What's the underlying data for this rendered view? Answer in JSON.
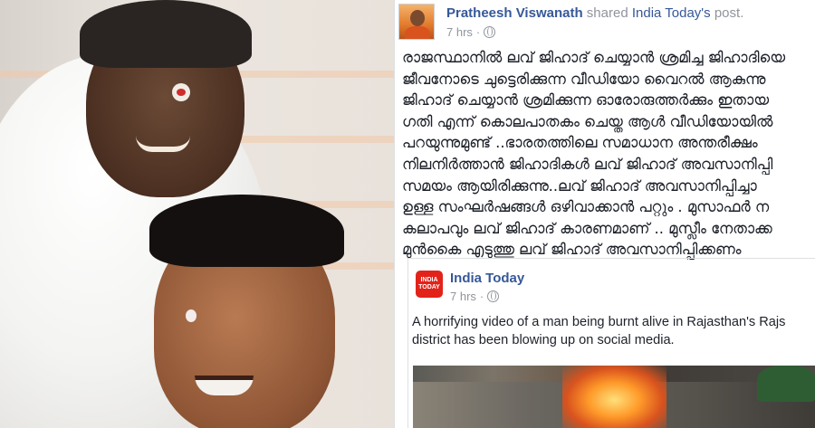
{
  "shared_post": {
    "author": "Pratheesh Viswanath",
    "shared_prefix": "shared",
    "shared_source": "India Today's",
    "shared_suffix": "post.",
    "timestamp": "7 hrs",
    "privacy_icon": "globe-icon",
    "text_lines": [
      "രാജസ്ഥാനിൽ ലവ് ജിഹാദ് ചെയ്യാൻ ശ്രമിച്ച ജിഹാദിയെ",
      "ജീവനോടെ ചുട്ടെരിക്കുന്ന വീഡിയോ വൈറൽ ആകുന്നു",
      "ജിഹാദ് ചെയ്യാൻ ശ്രമിക്കുന്ന ഓരോരുത്തർക്കും ഇതായ",
      "ഗതി എന്ന് കൊലപാതകം ചെയ്ത ആൾ വീഡിയോയിൽ",
      "പറയുന്നുമുണ്ട് ..ഭാരതത്തിലെ സമാധാന അന്തരീക്ഷം",
      "നിലനിർത്താൻ ജിഹാദികൾ ലവ് ജിഹാദ് അവസാനിപ്പി",
      "സമയം ആയിരിക്കുന്നു..ലവ് ജിഹാദ് അവസാനിപ്പിച്ചാ",
      "ഉള്ള സംഘർഷങ്ങൾ ഒഴിവാക്കാൻ പറ്റും . മുസാഫർ ന",
      "കലാപവും ലവ് ജിഹാദ് കാരണമാണ് .. മുസ്ലീം നേതാക്ക",
      "മുൻകൈ എടുത്തു ലവ് ജിഹാദ് അവസാനിപ്പിക്കണം"
    ]
  },
  "original_post": {
    "page_name": "India Today",
    "logo_text": "INDIA TODAY",
    "timestamp": "7 hrs",
    "privacy_icon": "globe-icon",
    "text_lines": [
      "A horrifying video of a man being burnt alive in Rajasthan's Rajs",
      "district has been blowing up on social media."
    ]
  },
  "colors": {
    "facebook_link": "#365899",
    "meta_gray": "#90949c",
    "text": "#1d2129",
    "india_today_red": "#e2231a"
  }
}
